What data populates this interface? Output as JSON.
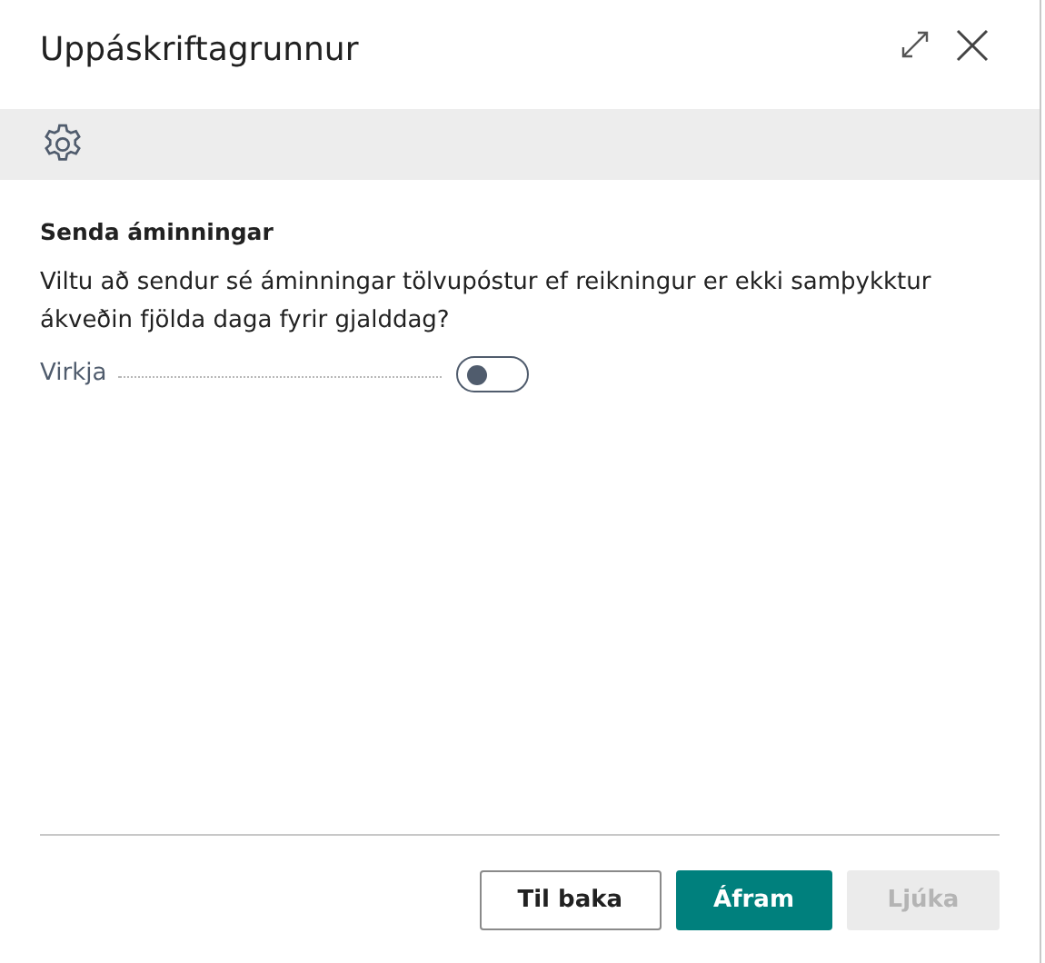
{
  "dialog": {
    "title": "Uppáskriftagrunnur"
  },
  "section": {
    "heading": "Senda áminningar",
    "description": "Viltu að sendur sé áminningar tölvupóstur ef reikningur er ekki samþykktur ákveðin fjölda daga fyrir gjalddag?",
    "fields": [
      {
        "label": "Virkja",
        "on": false
      }
    ]
  },
  "buttons": [
    {
      "label": "Til baka",
      "kind": "secondary",
      "disabled": false
    },
    {
      "label": "Áfram",
      "kind": "primary",
      "disabled": false
    },
    {
      "label": "Ljúka",
      "kind": "primary",
      "disabled": true
    }
  ]
}
